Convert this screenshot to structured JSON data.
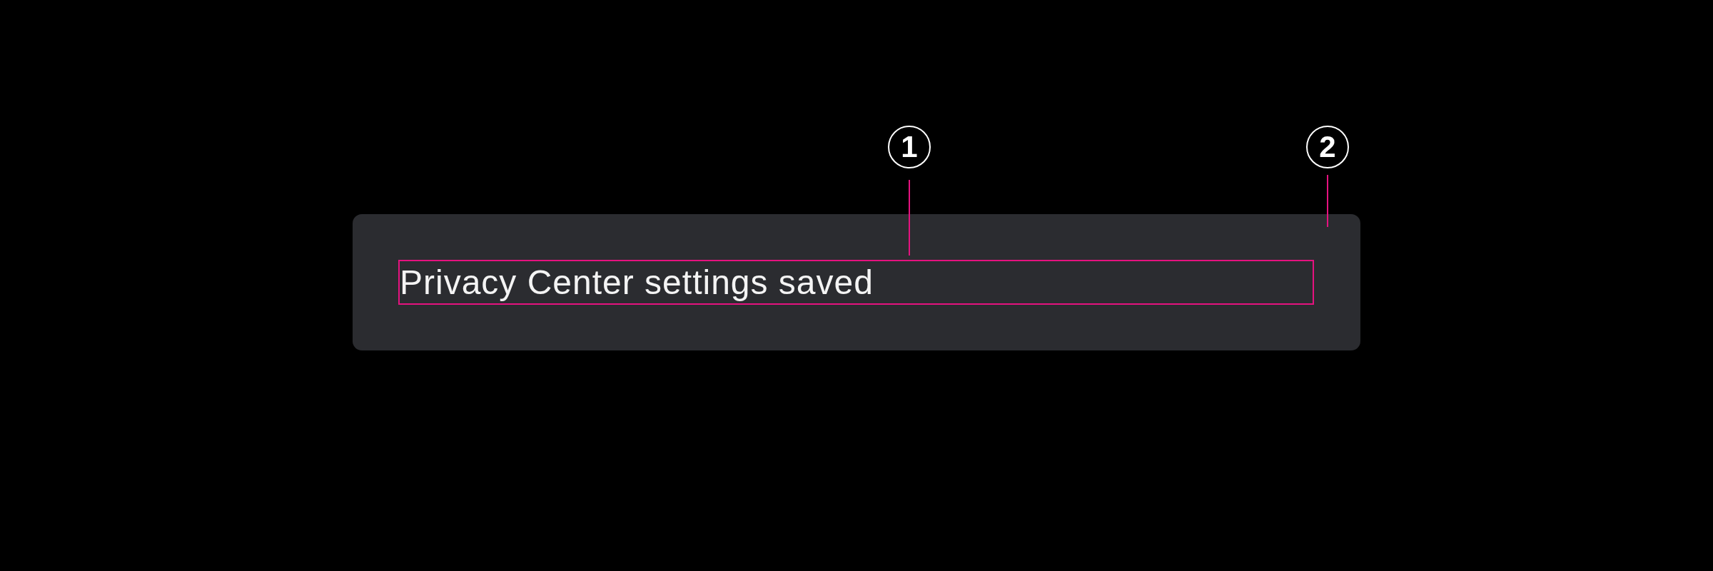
{
  "snackbar": {
    "message": "Privacy Center settings saved"
  },
  "callouts": [
    {
      "number": "1"
    },
    {
      "number": "2"
    }
  ]
}
